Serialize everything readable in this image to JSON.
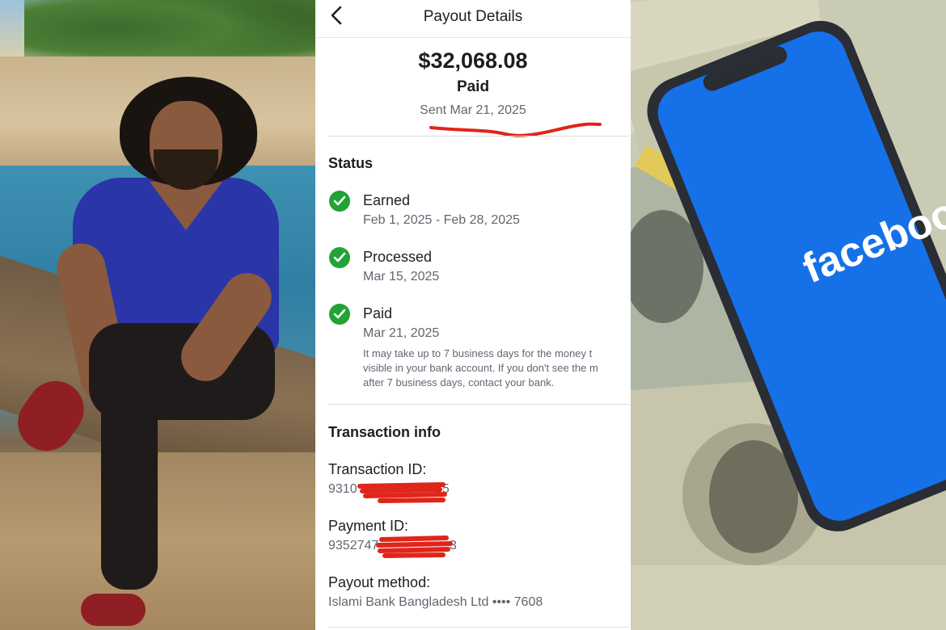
{
  "header": {
    "back_icon": "chevron-left-icon",
    "title": "Payout Details"
  },
  "summary": {
    "amount": "$32,068.08",
    "status": "Paid",
    "sent": "Sent Mar 21, 2025"
  },
  "status": {
    "heading": "Status",
    "steps": [
      {
        "label": "Earned",
        "date": "Feb 1, 2025 - Feb 28, 2025"
      },
      {
        "label": "Processed",
        "date": "Mar 15, 2025"
      },
      {
        "label": "Paid",
        "date": "Mar 21, 2025"
      }
    ],
    "note_lines": [
      "It may take up to 7 business days for the money t",
      "visible in your bank account. If you don't see the m",
      "after 7 business days, contact your bank."
    ]
  },
  "transaction": {
    "heading": "Transaction info",
    "transaction_id_label": "Transaction ID:",
    "transaction_id_prefix": "9310",
    "transaction_id_suffix": "85",
    "payment_id_label": "Payment ID:",
    "payment_id_prefix": "9352747",
    "payment_id_suffix": "3",
    "payout_method_label": "Payout method:",
    "payout_method_value": "Islami Bank Bangladesh Ltd •••• 7608"
  },
  "right_panel": {
    "brand_text": "facebook"
  },
  "colors": {
    "check_green": "#21a336",
    "redact_red": "#e0251b",
    "facebook_blue": "#1877f2"
  }
}
